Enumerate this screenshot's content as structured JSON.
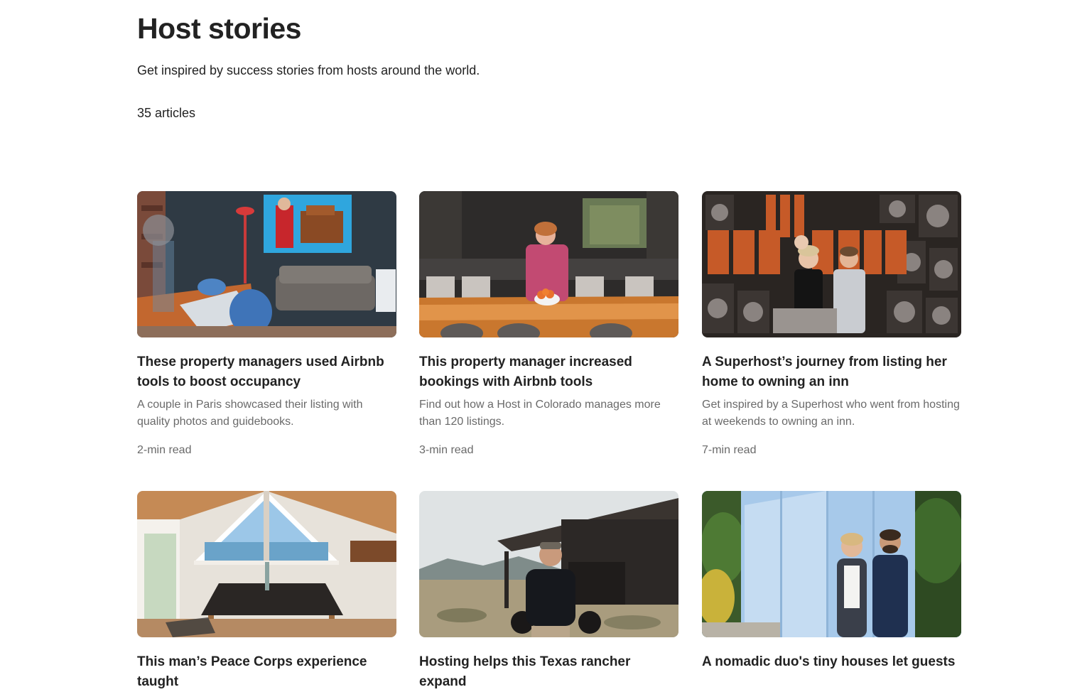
{
  "header": {
    "title": "Host stories",
    "subtitle": "Get inspired by success stories from hosts around the world.",
    "article_count": "35 articles"
  },
  "articles": [
    {
      "title": "These property managers used Airbnb tools to boost occupancy",
      "description": "A couple in Paris showcased their listing with quality photos and guidebooks.",
      "read_time": "2-min read",
      "image": "living-room-photo"
    },
    {
      "title": "This property manager increased bookings with Airbnb tools",
      "description": "Find out how a Host in Colorado manages more than 120 listings.",
      "read_time": "3-min read",
      "image": "kitchen-host-photo"
    },
    {
      "title": "A Superhost’s journey from listing her home to owning an inn",
      "description": "Get inspired by a Superhost who went from hosting at weekends to owning an inn.",
      "read_time": "7-min read",
      "image": "inn-cahoots-photo"
    },
    {
      "title": "This man’s Peace Corps experience taught",
      "image": "a-frame-cabin-photo"
    },
    {
      "title": "Hosting helps this Texas rancher expand",
      "image": "texas-rancher-photo"
    },
    {
      "title": "A nomadic duo's tiny houses let guests",
      "image": "tiny-house-couple-photo"
    }
  ]
}
